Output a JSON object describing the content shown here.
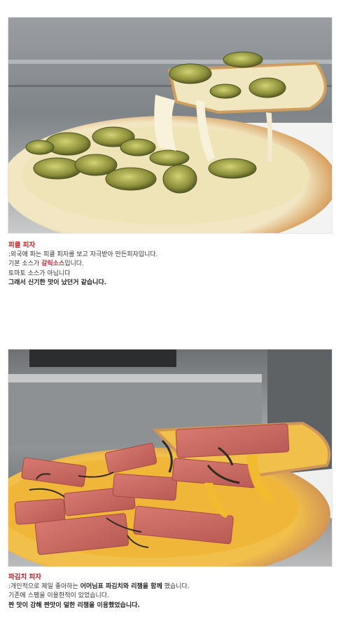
{
  "post": {
    "sections": [
      {
        "photo_alt": "pickle-pizza-photo",
        "title": "피클 피자",
        "lines": {
          "l1": ":외국에 파는 피클 피자를 보고 자극받아 만든피자입니다.",
          "l2_a": "기본 소스가 ",
          "l2_hl": "갈릭소스",
          "l2_b": "입니다.",
          "l3": "토마토 소스가 아닙니다",
          "l4": "그래서 신기한 맛이 났던거 같습니다."
        }
      },
      {
        "photo_alt": "kimchi-ham-pizza-photo",
        "title": "파김치 피자",
        "lines": {
          "l1_a": ":개인적으로 제일 좋아하는 ",
          "l1_hl": "어머님표 파김치와 리챔을 함께",
          "l1_b": " 했습니다.",
          "l2": "기존에 스팸을 이용한적이 있었습니다.",
          "l3": "짠 맛이 강해 짠맛이 덜한 리챔을 이용했었습니다."
        }
      }
    ]
  },
  "colors": {
    "title_red": "#b3252b",
    "highlight_red": "#c9283a",
    "text": "#333333"
  }
}
